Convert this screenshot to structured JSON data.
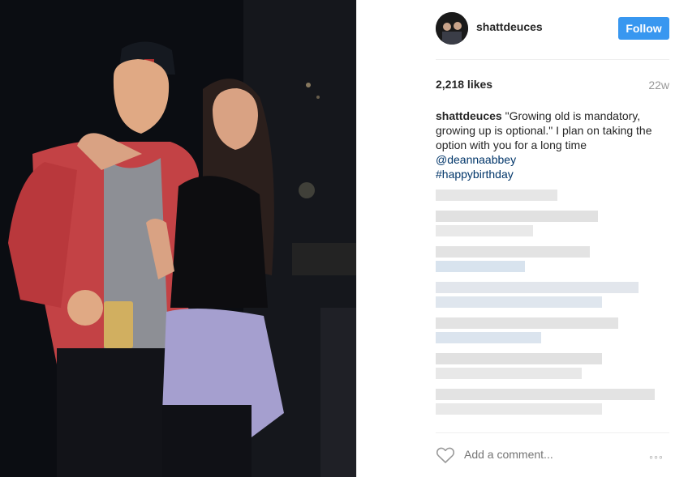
{
  "post": {
    "username": "shattdeuces",
    "follow_label": "Follow",
    "likes": "2,218 likes",
    "time_ago": "22w",
    "caption_user": "shattdeuces",
    "caption_text": "\"Growing old is mandatory, growing up is optional.\" I plan on taking the option with you for a long time",
    "mention": "@deannaabbey",
    "hashtag": "#happybirthday"
  },
  "comment_box": {
    "placeholder": "Add a comment..."
  },
  "icons": {
    "like": "heart-outline-icon",
    "options": "more-options-icon"
  },
  "colors": {
    "accent": "#3897f0",
    "link": "#003569",
    "muted": "#999999",
    "text": "#262626"
  }
}
